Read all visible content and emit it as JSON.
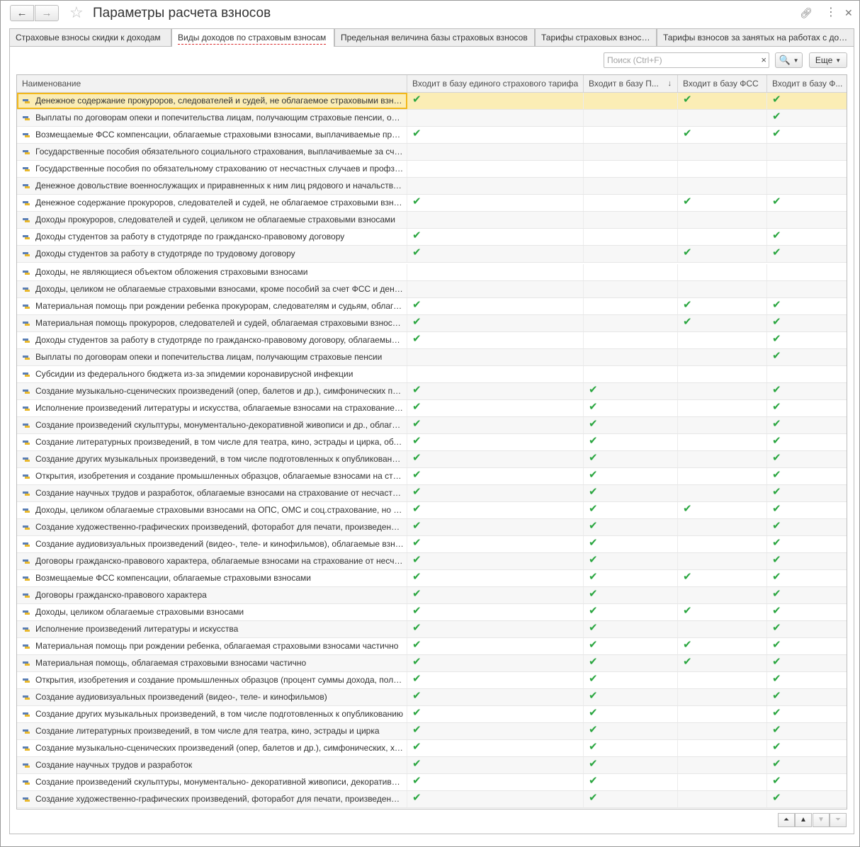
{
  "window": {
    "title": "Параметры расчета взносов",
    "back_icon": "arrow-left",
    "forward_icon": "arrow-right",
    "favorite_icon": "star",
    "link_icon": "link",
    "more_icon": "vertical-dots",
    "close_icon": "close"
  },
  "tabs": [
    {
      "label": "Страховые взносы скидки к доходам",
      "active": false
    },
    {
      "label": "Виды доходов по страховым взносам",
      "active": true
    },
    {
      "label": "Предельная величина базы страховых взносов",
      "active": false
    },
    {
      "label": "Тарифы страховых взносов",
      "active": false
    },
    {
      "label": "Тарифы взносов за занятых на работах с доп. тарифом",
      "active": false
    }
  ],
  "toolbar": {
    "search_placeholder": "Поиск (Ctrl+F)",
    "search_value": "",
    "clear_label": "×",
    "find_label": "🔍",
    "more_label": "Еще"
  },
  "table": {
    "columns": [
      "Наименование",
      "Входит в базу единого страхового тарифа",
      "Входит в базу П...",
      "Входит в базу ФСС",
      "Входит в базу Ф..."
    ],
    "sorted_column": 2,
    "sort_direction": "descending",
    "check_glyph": "✔",
    "check_color": "#2aa640",
    "selection_color": "#fbedb5",
    "rows": [
      {
        "name": "Денежное содержание прокуроров, следователей и судей, не облагаемое страховыми взносами на ОПС",
        "c": [
          true,
          false,
          true,
          true
        ],
        "selected": true
      },
      {
        "name": "Выплаты по договорам опеки и попечительства лицам, получающим страховые пенсии, облагаемые взносами",
        "c": [
          false,
          false,
          false,
          true
        ]
      },
      {
        "name": "Возмещаемые ФСС компенсации, облагаемые страховыми взносами, выплачиваемые прокурорам",
        "c": [
          true,
          false,
          true,
          true
        ]
      },
      {
        "name": "Государственные пособия обязательного социального страхования, выплачиваемые за счет ФСС",
        "c": [
          false,
          false,
          false,
          false
        ]
      },
      {
        "name": "Государственные пособия по обязательному страхованию от несчастных случаев и профзаболеваний",
        "c": [
          false,
          false,
          false,
          false
        ]
      },
      {
        "name": "Денежное довольствие военнослужащих и приравненных к ним лиц рядового и начальствующего состава",
        "c": [
          false,
          false,
          false,
          false
        ]
      },
      {
        "name": "Денежное содержание прокуроров, следователей и судей, не облагаемое страховыми взносами на ОМС",
        "c": [
          true,
          false,
          true,
          true
        ]
      },
      {
        "name": "Доходы прокуроров, следователей и судей, целиком не облагаемые страховыми взносами",
        "c": [
          false,
          false,
          false,
          false
        ]
      },
      {
        "name": "Доходы студентов за работу в студотряде по гражданско-правовому договору",
        "c": [
          true,
          false,
          false,
          true
        ]
      },
      {
        "name": "Доходы студентов за работу в студотряде по трудовому договору",
        "c": [
          true,
          false,
          true,
          true
        ]
      },
      {
        "name": "Доходы, не являющиеся объектом обложения страховыми взносами",
        "c": [
          false,
          false,
          false,
          false
        ],
        "gap": true
      },
      {
        "name": "Доходы, целиком не облагаемые страховыми взносами, кроме пособий за счет ФСС и денежного довольствия",
        "c": [
          false,
          false,
          false,
          false
        ]
      },
      {
        "name": "Материальная помощь при рождении ребенка прокурорам, следователям и судьям, облагаемая частично",
        "c": [
          true,
          false,
          true,
          true
        ]
      },
      {
        "name": "Материальная помощь прокуроров, следователей и судей, облагаемая страховыми взносами частично",
        "c": [
          true,
          false,
          true,
          true
        ]
      },
      {
        "name": "Доходы студентов за работу в студотряде по гражданско-правовому договору, облагаемые взносами",
        "c": [
          true,
          false,
          false,
          true
        ]
      },
      {
        "name": "Выплаты по договорам опеки и попечительства лицам, получающим страховые пенсии",
        "c": [
          false,
          false,
          false,
          true
        ]
      },
      {
        "name": "Субсидии из федерального бюджета из-за эпидемии коронавирусной инфекции",
        "c": [
          false,
          false,
          false,
          false
        ]
      },
      {
        "name": "Создание музыкально-сценических произведений (опер, балетов и др.), симфонических произведений",
        "c": [
          true,
          true,
          false,
          true
        ]
      },
      {
        "name": "Исполнение произведений литературы и искусства, облагаемые взносами на страхование от несчастных случаев",
        "c": [
          true,
          true,
          false,
          true
        ]
      },
      {
        "name": "Создание произведений скульптуры, монументально-декоративной живописи и др., облагаемые взносами",
        "c": [
          true,
          true,
          false,
          true
        ]
      },
      {
        "name": "Создание литературных произведений, в том числе для театра, кино, эстрады и цирка, облагаемые взносами",
        "c": [
          true,
          true,
          false,
          true
        ]
      },
      {
        "name": "Создание других музыкальных произведений, в том числе подготовленных к опубликованию, облагаемые взносами",
        "c": [
          true,
          true,
          false,
          true
        ]
      },
      {
        "name": "Открытия, изобретения и создание промышленных образцов, облагаемые взносами на страхование",
        "c": [
          true,
          true,
          false,
          true
        ]
      },
      {
        "name": "Создание научных трудов и разработок, облагаемые взносами на страхование от несчастных случаев",
        "c": [
          true,
          true,
          false,
          true
        ]
      },
      {
        "name": "Доходы, целиком облагаемые страховыми взносами на ОПС, ОМС и соц.страхование, но не на страхование от НС",
        "c": [
          true,
          true,
          true,
          true
        ]
      },
      {
        "name": "Создание художественно-графических произведений, фоторабот для печати, произведений архитектуры",
        "c": [
          true,
          true,
          false,
          true
        ]
      },
      {
        "name": "Создание аудиовизуальных произведений (видео-, теле- и кинофильмов), облагаемые взносами на страхование",
        "c": [
          true,
          true,
          false,
          true
        ]
      },
      {
        "name": "Договоры гражданско-правового характера, облагаемые взносами на страхование от несчастных случаев",
        "c": [
          true,
          true,
          false,
          true
        ]
      },
      {
        "name": "Возмещаемые ФСС компенсации, облагаемые страховыми взносами",
        "c": [
          true,
          true,
          true,
          true
        ]
      },
      {
        "name": "Договоры гражданско-правового характера",
        "c": [
          true,
          true,
          false,
          true
        ]
      },
      {
        "name": "Доходы, целиком облагаемые страховыми взносами",
        "c": [
          true,
          true,
          true,
          true
        ]
      },
      {
        "name": "Исполнение произведений литературы и искусства",
        "c": [
          true,
          true,
          false,
          true
        ]
      },
      {
        "name": "Материальная помощь при рождении ребенка, облагаемая страховыми взносами частично",
        "c": [
          true,
          true,
          true,
          true
        ]
      },
      {
        "name": "Материальная помощь, облагаемая страховыми взносами частично",
        "c": [
          true,
          true,
          true,
          true
        ]
      },
      {
        "name": "Открытия, изобретения и создание промышленных образцов (процент суммы дохода, полученного за первые два года)",
        "c": [
          true,
          true,
          false,
          true
        ]
      },
      {
        "name": "Создание аудиовизуальных произведений (видео-, теле- и кинофильмов)",
        "c": [
          true,
          true,
          false,
          true
        ]
      },
      {
        "name": "Создание других музыкальных произведений, в том числе подготовленных к опубликованию",
        "c": [
          true,
          true,
          false,
          true
        ]
      },
      {
        "name": "Создание литературных произведений, в том числе для театра, кино, эстрады и цирка",
        "c": [
          true,
          true,
          false,
          true
        ]
      },
      {
        "name": "Создание музыкально-сценических произведений (опер, балетов и др.), симфонических, хоровых",
        "c": [
          true,
          true,
          false,
          true
        ]
      },
      {
        "name": "Создание научных трудов и разработок",
        "c": [
          true,
          true,
          false,
          true
        ]
      },
      {
        "name": "Создание произведений скульптуры, монументально- декоративной живописи, декоративно-прикладного искусства",
        "c": [
          true,
          true,
          false,
          true
        ]
      },
      {
        "name": "Создание художественно-графических произведений, фоторабот для печати, произведений архитектуры и дизайна",
        "c": [
          true,
          true,
          false,
          true
        ]
      }
    ]
  },
  "scroll_buttons": {
    "first": "⏶",
    "up": "▲",
    "down": "▼",
    "last": "⏷"
  }
}
